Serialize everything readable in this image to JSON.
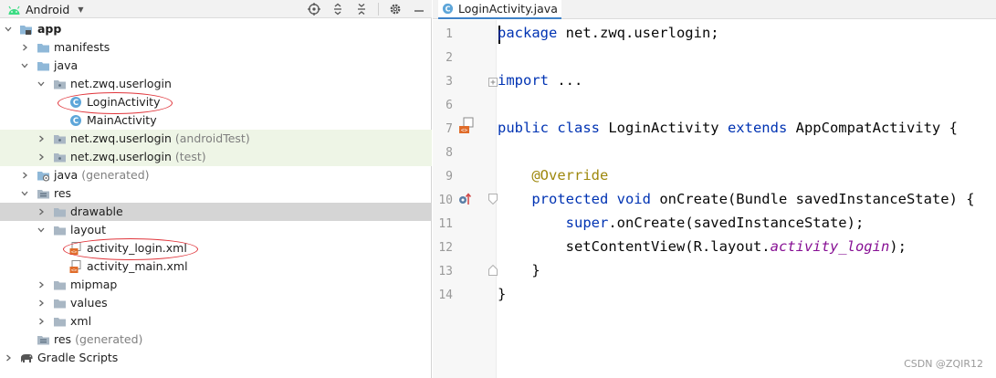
{
  "project_panel": {
    "view_mode": "Android",
    "tree": [
      {
        "label": "app",
        "hint": ""
      },
      {
        "label": "manifests",
        "hint": ""
      },
      {
        "label": "java",
        "hint": ""
      },
      {
        "label": "net.zwq.userlogin",
        "hint": ""
      },
      {
        "label": "LoginActivity",
        "hint": ""
      },
      {
        "label": "MainActivity",
        "hint": ""
      },
      {
        "label": "net.zwq.userlogin",
        "hint": "(androidTest)"
      },
      {
        "label": "net.zwq.userlogin",
        "hint": "(test)"
      },
      {
        "label": "java",
        "hint": "(generated)"
      },
      {
        "label": "res",
        "hint": ""
      },
      {
        "label": "drawable",
        "hint": ""
      },
      {
        "label": "layout",
        "hint": ""
      },
      {
        "label": "activity_login.xml",
        "hint": ""
      },
      {
        "label": "activity_main.xml",
        "hint": ""
      },
      {
        "label": "mipmap",
        "hint": ""
      },
      {
        "label": "values",
        "hint": ""
      },
      {
        "label": "xml",
        "hint": ""
      },
      {
        "label": "res",
        "hint": "(generated)"
      },
      {
        "label": "Gradle Scripts",
        "hint": ""
      }
    ]
  },
  "editor": {
    "tab": {
      "label": "LoginActivity.java",
      "close_icon": "close-icon"
    },
    "lines": [
      {
        "no": "1",
        "parts": [
          {
            "t": "package",
            "c": "kw"
          },
          {
            "t": " net.zwq.userlogin;",
            "c": ""
          }
        ]
      },
      {
        "no": "2",
        "parts": []
      },
      {
        "no": "3",
        "parts": [
          {
            "t": "import",
            "c": "kw"
          },
          {
            "t": " ...",
            "c": ""
          }
        ]
      },
      {
        "no": "6",
        "parts": []
      },
      {
        "no": "7",
        "parts": [
          {
            "t": "public class",
            "c": "kw"
          },
          {
            "t": " LoginActivity ",
            "c": ""
          },
          {
            "t": "extends",
            "c": "kw"
          },
          {
            "t": " AppCompatActivity {",
            "c": ""
          }
        ]
      },
      {
        "no": "8",
        "parts": []
      },
      {
        "no": "9",
        "parts": [
          {
            "t": "    ",
            "c": ""
          },
          {
            "t": "@Override",
            "c": "an"
          }
        ]
      },
      {
        "no": "10",
        "parts": [
          {
            "t": "    ",
            "c": ""
          },
          {
            "t": "protected void",
            "c": "kw"
          },
          {
            "t": " onCreate(Bundle savedInstanceState) {",
            "c": ""
          }
        ]
      },
      {
        "no": "11",
        "parts": [
          {
            "t": "        ",
            "c": ""
          },
          {
            "t": "super",
            "c": "kw"
          },
          {
            "t": ".onCreate(savedInstanceState);",
            "c": ""
          }
        ]
      },
      {
        "no": "12",
        "parts": [
          {
            "t": "        setContentView(R.layout.",
            "c": ""
          },
          {
            "t": "activity_login",
            "c": "it"
          },
          {
            "t": ");",
            "c": ""
          }
        ]
      },
      {
        "no": "13",
        "parts": [
          {
            "t": "    }",
            "c": ""
          }
        ]
      },
      {
        "no": "14",
        "parts": [
          {
            "t": "}",
            "c": ""
          }
        ]
      }
    ]
  },
  "watermark": "CSDN @ZQIR12",
  "colors": {
    "keyword": "#0033b3",
    "annotation": "#9e880d",
    "italic_field": "#871094",
    "folder": "#8fb8d8",
    "android_green": "#3ddc84",
    "annotation_ellipse": "#e0353b",
    "test_row_bg": "#eef5e6",
    "selected_row_bg": "#d5d5d5"
  }
}
